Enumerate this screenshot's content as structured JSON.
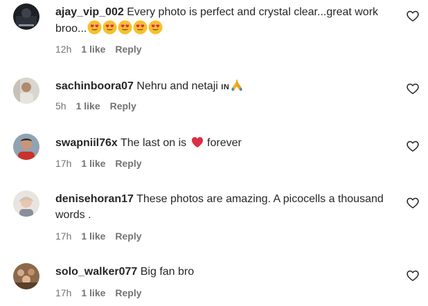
{
  "comments": [
    {
      "username": "ajay_vip_002",
      "text": "Every photo is perfect and crystal clear...great work broo...",
      "emoji": [
        "heart-eyes",
        "heart-eyes",
        "heart-eyes",
        "heart-eyes",
        "heart-eyes"
      ],
      "time": "12h",
      "likes": "1 like",
      "reply": "Reply"
    },
    {
      "username": "sachinboora07",
      "text": "Nehru and netaji",
      "suffix_badge": "IN",
      "emoji": [
        "folded-hands"
      ],
      "time": "5h",
      "likes": "1 like",
      "reply": "Reply"
    },
    {
      "username": "swapniil76x",
      "text_before": "The last on is",
      "emoji": [
        "red-heart"
      ],
      "text_after": "forever",
      "time": "17h",
      "likes": "1 like",
      "reply": "Reply"
    },
    {
      "username": "denisehoran17",
      "text": "These photos are amazing. A picocells a thousand words .",
      "time": "17h",
      "likes": "1 like",
      "reply": "Reply"
    },
    {
      "username": "solo_walker077",
      "text": "Big fan bro",
      "time": "17h",
      "likes": "1 like",
      "reply": "Reply"
    }
  ],
  "colors": {
    "text": "#262626",
    "meta": "#737373",
    "heart_red": "#e0245e",
    "emoji_yellow": "#f7c02b"
  },
  "icons": {
    "like": "heart-outline-icon"
  }
}
